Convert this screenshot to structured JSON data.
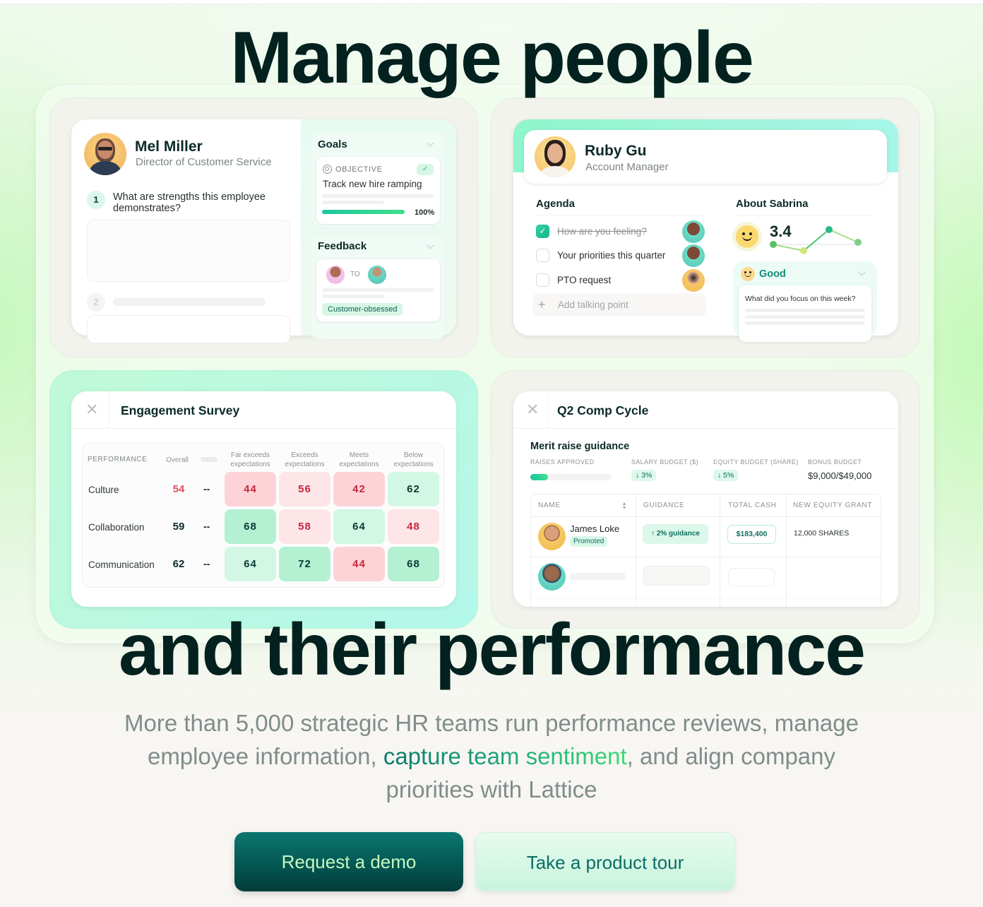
{
  "hero": {
    "title_line1": "Manage people",
    "title_line2": "and their performance",
    "lead_before": "More than 5,000 strategic HR teams run performance reviews, manage employee information, ",
    "lead_highlight": "capture team sentiment",
    "lead_after": ", and align company priorities with Lattice",
    "buttons": {
      "primary": "Request a demo",
      "secondary": "Take a product tour"
    }
  },
  "review_card": {
    "employee_name": "Mel Miller",
    "employee_title": "Director of Customer Service",
    "questions": [
      {
        "number": "1",
        "text": "What are strengths this employee demonstrates?"
      },
      {
        "number": "2",
        "text": ""
      }
    ],
    "goals": {
      "title": "Goals",
      "objective_label": "OBJECTIVE",
      "objective_name": "Track new hire ramping",
      "progress_percent": 100,
      "progress_text": "100%"
    },
    "feedback": {
      "title": "Feedback",
      "to_label": "TO",
      "tag": "Customer-obsessed"
    }
  },
  "one_on_one_card": {
    "name": "Ruby Gu",
    "title": "Account Manager",
    "agenda": {
      "title": "Agenda",
      "items": [
        {
          "text": "How are you feeling?",
          "checked": true
        },
        {
          "text": "Your priorities this quarter",
          "checked": false
        },
        {
          "text": "PTO request",
          "checked": false
        }
      ],
      "add_placeholder": "Add talking point"
    },
    "about": {
      "title": "About Sabrina",
      "score": "3.4",
      "trend": [
        3.2,
        2.9,
        3.9,
        3.3
      ],
      "mood": "Good",
      "prompt": "What did you focus on this week?"
    }
  },
  "survey_card": {
    "title": "Engagement Survey",
    "header_first": "PERFORMANCE",
    "header_overall": "Overall",
    "columns": [
      "Far exceeds expectations",
      "Exceeds expectations",
      "Meets expectations",
      "Below expectations"
    ],
    "rows": [
      {
        "label": "Culture",
        "overall": "54",
        "overall_status": "negative",
        "dash": "--",
        "values": [
          "44",
          "56",
          "42",
          "62"
        ],
        "status": [
          "red",
          "lred",
          "red",
          "lgreen"
        ]
      },
      {
        "label": "Collaboration",
        "overall": "59",
        "overall_status": "neutral",
        "dash": "--",
        "values": [
          "68",
          "58",
          "64",
          "48"
        ],
        "status": [
          "green",
          "lred",
          "lgreen",
          "lred"
        ]
      },
      {
        "label": "Communication",
        "overall": "62",
        "overall_status": "neutral",
        "dash": "--",
        "values": [
          "64",
          "72",
          "44",
          "68"
        ],
        "status": [
          "lgreen",
          "green",
          "red",
          "green"
        ]
      }
    ]
  },
  "comp_card": {
    "title": "Q2 Comp Cycle",
    "section_title": "Merit raise guidance",
    "stats": {
      "raises_label": "RAISES APPROVED",
      "raises_progress_percent": 22,
      "salary_label": "SALARY BUDGET ($)",
      "salary_value": "↓ 3%",
      "equity_label": "EQUITY BUDGET (SHARE)",
      "equity_value": "↓ 5%",
      "bonus_label": "BONUS BUDGET",
      "bonus_value": "$9,000/$49,000"
    },
    "table": {
      "headers": [
        "NAME",
        "GUIDANCE",
        "TOTAL CASH",
        "NEW EQUITY GRANT"
      ],
      "rows": [
        {
          "name": "James Loke",
          "badge": "Promoted",
          "guidance": "↑  2% guidance",
          "total_cash": "$183,400",
          "equity": "12,000 SHARES"
        }
      ]
    }
  }
}
